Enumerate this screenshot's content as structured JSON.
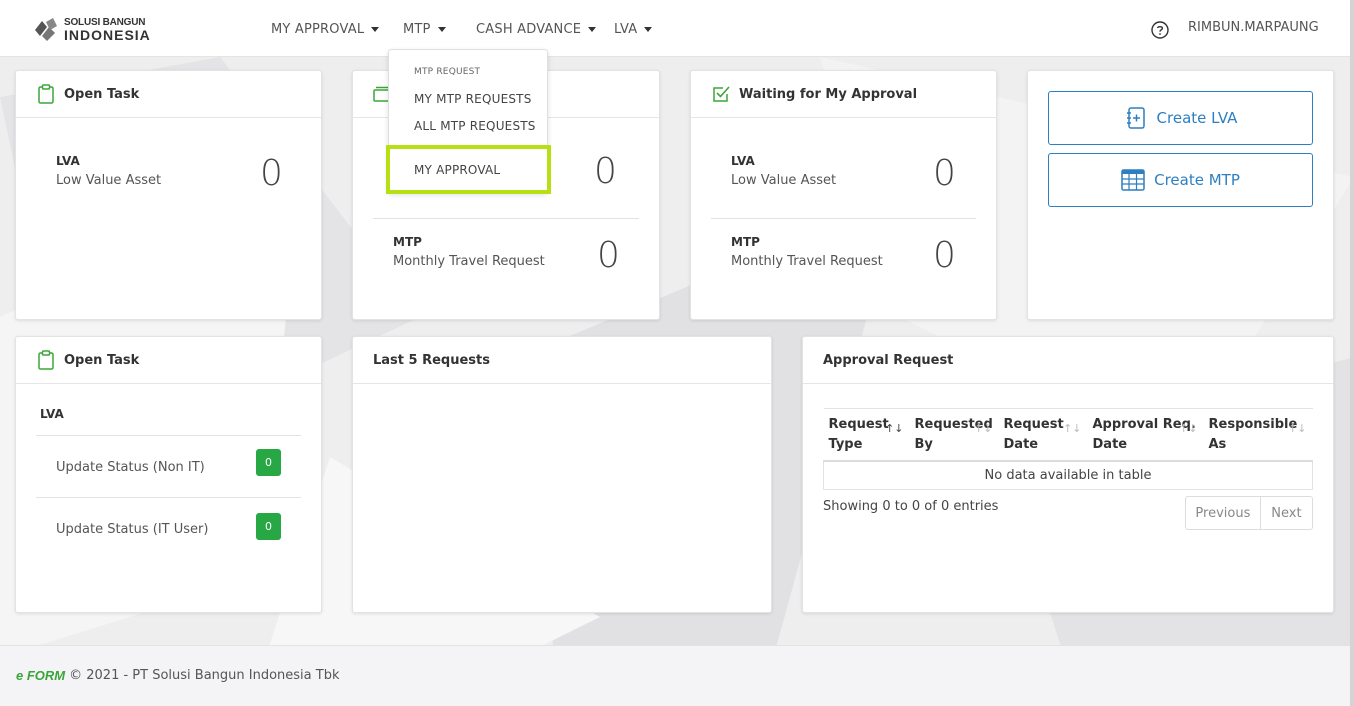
{
  "brand": {
    "line1": "SOLUSI BANGUN",
    "line2": "INDONESIA"
  },
  "nav": {
    "items": [
      {
        "label": "MY APPROVAL"
      },
      {
        "label": "MTP"
      },
      {
        "label": "CASH ADVANCE"
      },
      {
        "label": "LVA"
      }
    ],
    "user": "RIMBUN.MARPAUNG"
  },
  "dropdown": {
    "header": "MTP REQUEST",
    "items": [
      "MY MTP REQUESTS",
      "ALL MTP REQUESTS",
      "MY APPROVAL"
    ],
    "highlight_color": "#b7e014"
  },
  "cards": {
    "open_task_top": {
      "title": "Open Task",
      "lva_label": "LVA",
      "lva_desc": "Low Value Asset",
      "lva_count": "0"
    },
    "middle": {
      "count_top": "0",
      "mtp_label": "MTP",
      "mtp_desc": "Monthly Travel Request",
      "mtp_count": "0"
    },
    "waiting_approval": {
      "title": "Waiting for My Approval",
      "lva_label": "LVA",
      "lva_desc": "Low Value Asset",
      "lva_count": "0",
      "mtp_label": "MTP",
      "mtp_desc": "Monthly Travel Request",
      "mtp_count": "0"
    },
    "actions": {
      "create_lva": "Create LVA",
      "create_mtp": "Create MTP"
    },
    "open_task_bottom": {
      "title": "Open Task",
      "section": "LVA",
      "items": [
        {
          "label": "Update Status (Non IT)",
          "count": "0"
        },
        {
          "label": "Update Status (IT User)",
          "count": "0"
        }
      ]
    },
    "last_requests": {
      "title": "Last 5 Requests"
    },
    "approval_request": {
      "title": "Approval Request",
      "columns": [
        {
          "l1": "Request",
          "l2": "Type"
        },
        {
          "l1": "Requested",
          "l2": "By"
        },
        {
          "l1": "Request",
          "l2": "Date"
        },
        {
          "l1": "Approval Req.",
          "l2": "Date"
        },
        {
          "l1": "Responsible",
          "l2": "As"
        }
      ],
      "empty_text": "No data available in table",
      "info": "Showing 0 to 0 of 0 entries",
      "prev": "Previous",
      "next": "Next"
    }
  },
  "footer": {
    "logo": "e FORM",
    "text": "© 2021 - PT Solusi Bangun Indonesia Tbk"
  },
  "colors": {
    "accent_blue": "#2d7fc1",
    "success_green": "#28a745",
    "icon_green": "#3aa53a"
  }
}
